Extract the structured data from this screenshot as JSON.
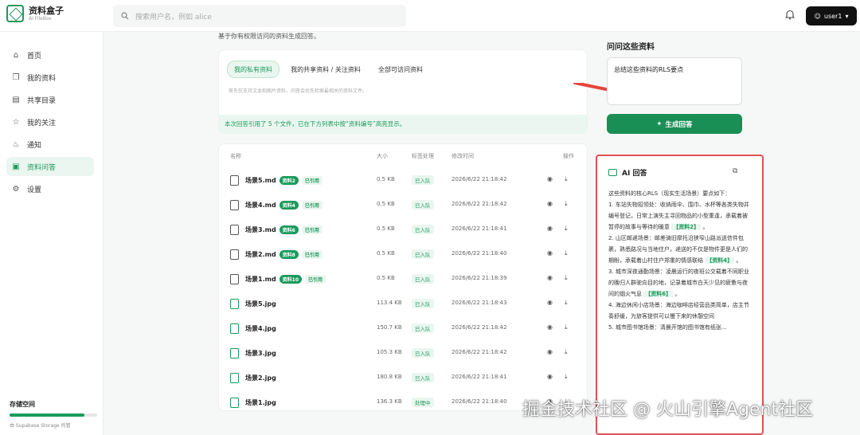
{
  "app": {
    "title": "资料盒子",
    "subtitle": "AI FileBox"
  },
  "search": {
    "placeholder": "搜索用户名，例如 alice"
  },
  "user": {
    "name": "user1"
  },
  "sidebar": {
    "items": [
      {
        "label": "首页",
        "icon": "home-icon"
      },
      {
        "label": "我的资料",
        "icon": "files-icon"
      },
      {
        "label": "共享目录",
        "icon": "folder-icon"
      },
      {
        "label": "我的关注",
        "icon": "star-icon"
      },
      {
        "label": "通知",
        "icon": "bell-icon"
      },
      {
        "label": "资料问答",
        "icon": "robot-icon"
      },
      {
        "label": "设置",
        "icon": "gear-icon"
      }
    ],
    "storage": {
      "label": "存储空间",
      "sub": "由 Supabase Storage 托管",
      "usage": 0.85
    }
  },
  "main": {
    "desc": "基于你有权限访问的资料生成回答。",
    "tabs": [
      "我的私有资料",
      "我的共享资料 / 关注资料",
      "全部可访问资料"
    ],
    "hint": "首先仅支持文本和图片资料，问答会优先检索最相关的资料文件。",
    "notice": "本次回答引用了 5 个文件，已在下方列表中按“资料编号”高亮显示。",
    "columns": {
      "name": "名称",
      "size": "大小",
      "status": "标签处理",
      "time": "修改时间",
      "action": "操作"
    },
    "rows": [
      {
        "name": "场景5.md",
        "badge": "资料2",
        "cited": "已引用",
        "size": "0.5 KB",
        "status": "已入队",
        "time": "2026/6/22 21:18:42",
        "type": "md"
      },
      {
        "name": "场景4.md",
        "badge": "资料4",
        "cited": "已引用",
        "size": "0.5 KB",
        "status": "已入队",
        "time": "2026/6/22 21:18:42",
        "type": "md"
      },
      {
        "name": "场景3.md",
        "badge": "资料6",
        "cited": "已引用",
        "size": "0.5 KB",
        "status": "已入队",
        "time": "2026/6/22 21:18:41",
        "type": "md"
      },
      {
        "name": "场景2.md",
        "badge": "资料8",
        "cited": "已引用",
        "size": "0.5 KB",
        "status": "已入队",
        "time": "2026/6/22 21:18:40",
        "type": "md"
      },
      {
        "name": "场景1.md",
        "badge": "资料10",
        "cited": "已引用",
        "size": "0.5 KB",
        "status": "已入队",
        "time": "2026/6/22 21:18:39",
        "type": "md"
      },
      {
        "name": "场景5.jpg",
        "badge": "",
        "cited": "",
        "size": "113.4 KB",
        "status": "已入队",
        "time": "2026/6/22 21:18:43",
        "type": "img"
      },
      {
        "name": "场景4.jpg",
        "badge": "",
        "cited": "",
        "size": "150.7 KB",
        "status": "已入队",
        "time": "2026/6/22 21:18:42",
        "type": "img"
      },
      {
        "name": "场景3.jpg",
        "badge": "",
        "cited": "",
        "size": "105.3 KB",
        "status": "已入队",
        "time": "2026/6/22 21:18:42",
        "type": "img"
      },
      {
        "name": "场景2.jpg",
        "badge": "",
        "cited": "",
        "size": "180.8 KB",
        "status": "已入队",
        "time": "2026/6/22 21:18:41",
        "type": "img"
      },
      {
        "name": "场景1.jpg",
        "badge": "",
        "cited": "",
        "size": "136.3 KB",
        "status": "处理中",
        "time": "2026/6/22 21:18:40",
        "type": "img"
      }
    ]
  },
  "ask": {
    "title": "问问这些资料",
    "value": "总结这些资料的RLS要点",
    "button": "生成回答"
  },
  "ai": {
    "title": "AI 回答",
    "intro": "这些资料的核心RLS（现实生活场景）要点如下：",
    "p1": "1. 车站失物招领处：收纳雨伞、围巾、水杯等各类失物并编号登记，日常上演失主寻回物品的小型重逢，承载着被暂停的故事与等待的暖意",
    "p1c": "【资料2】",
    "p2": "2. 山区邮递场景：邮差骑旧摩托沿狭窄山路派送信件包裹，熟悉路况与当地住户，递送的不仅是物件更是人们的期盼，承载着山村住户郑重的情感联结",
    "p2c": "【资料4】",
    "p3": "3. 城市深夜通勤场景：凌晨运行的夜班公交载着不同职业的晚归人群驶向目的地，记录着城市白天少见的疲惫与夜间的烟火气息",
    "p3c": "【资料6】",
    "p4": "4. 海边休闲小店场景：海边咖啡店经营品类简单，店主节奏舒缓，为旅客提供可以慢下来的休憩空间",
    "p5": "5. 城市图书馆场景：清晨开馆的图书馆有纸张..."
  },
  "watermark": "掘金技术社区 @ 火山引擎Agent社区",
  "colors": {
    "accent": "#1a9a5c",
    "button": "#1a8f55",
    "highlight_border": "#e05252",
    "arrow": "#e8453c"
  }
}
